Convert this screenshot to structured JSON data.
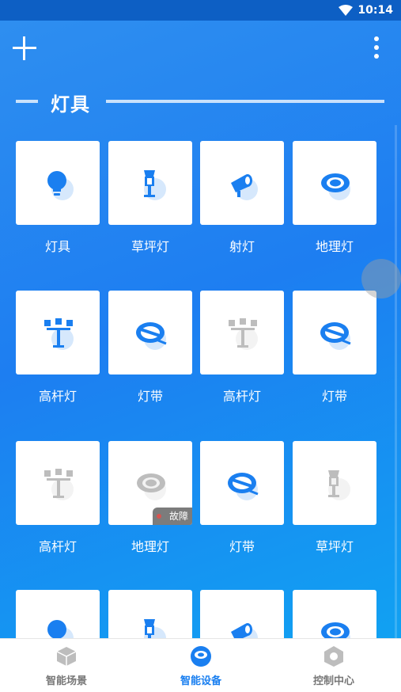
{
  "statusbar": {
    "time": "10:14"
  },
  "section": {
    "title": "灯具"
  },
  "devices": [
    {
      "label": "灯具",
      "icon": "bulb",
      "online": true
    },
    {
      "label": "草坪灯",
      "icon": "lawn",
      "online": true
    },
    {
      "label": "射灯",
      "icon": "spot",
      "online": true
    },
    {
      "label": "地理灯",
      "icon": "ground",
      "online": true
    },
    {
      "label": "高杆灯",
      "icon": "pole",
      "online": true
    },
    {
      "label": "灯带",
      "icon": "strip",
      "online": true
    },
    {
      "label": "高杆灯",
      "icon": "pole",
      "online": false
    },
    {
      "label": "灯带",
      "icon": "strip",
      "online": true
    },
    {
      "label": "高杆灯",
      "icon": "pole",
      "online": false
    },
    {
      "label": "地理灯",
      "icon": "ground",
      "online": false,
      "badge": "故障"
    },
    {
      "label": "灯带",
      "icon": "strip",
      "online": true
    },
    {
      "label": "草坪灯",
      "icon": "lawn",
      "online": false
    },
    {
      "label": "",
      "icon": "bulb",
      "online": true
    },
    {
      "label": "",
      "icon": "lawn",
      "online": true
    },
    {
      "label": "",
      "icon": "spot",
      "online": true
    },
    {
      "label": "",
      "icon": "ground",
      "online": true
    }
  ],
  "tabs": [
    {
      "label": "智能场景",
      "icon": "cube-icon",
      "active": false
    },
    {
      "label": "智能设备",
      "icon": "device-icon",
      "active": true
    },
    {
      "label": "控制中心",
      "icon": "hexagon-icon",
      "active": false
    }
  ],
  "colors": {
    "accent": "#1a7ff0",
    "offline": "#bdbdbd",
    "tab_inactive": "#777777"
  }
}
